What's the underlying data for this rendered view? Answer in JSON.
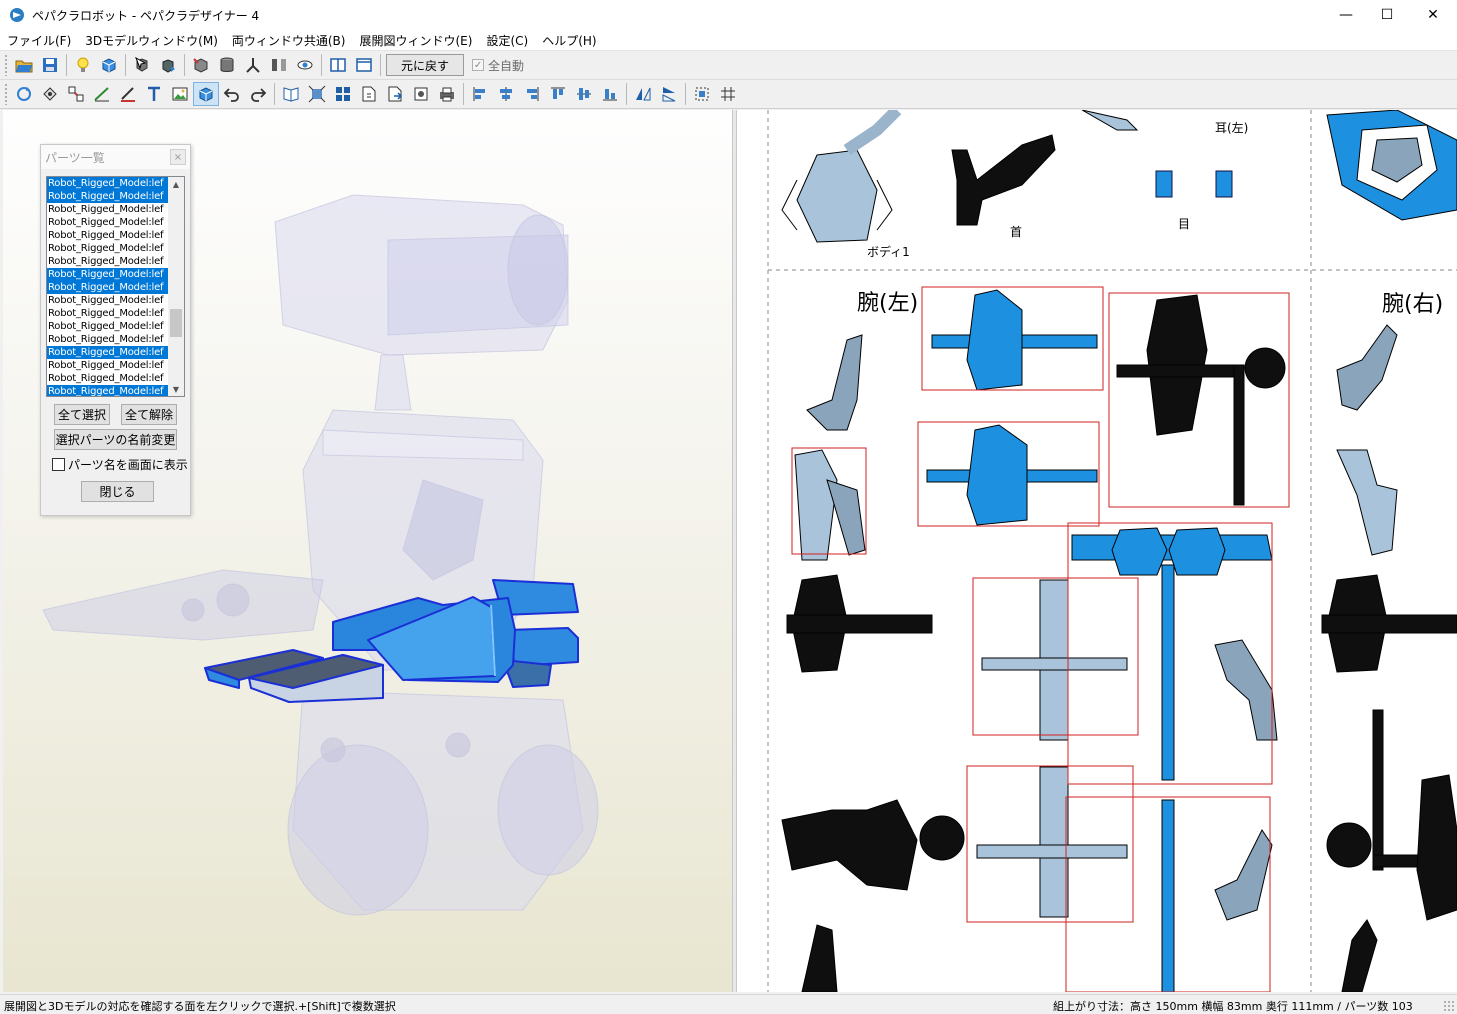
{
  "window": {
    "title": "ペパクラロボット - ペパクラデザイナー 4",
    "minimize": "—",
    "maximize": "☐",
    "close": "✕"
  },
  "menu": [
    "ファイル(F)",
    "3Dモデルウィンドウ(M)",
    "両ウィンドウ共通(B)",
    "展開図ウィンドウ(E)",
    "設定(C)",
    "ヘルプ(H)"
  ],
  "toolbar1": {
    "icons": [
      "open-icon",
      "save-icon",
      "lightbulb-icon",
      "texture-icon",
      "select-part-icon",
      "move-part-icon",
      "box-icon",
      "cylinder-icon",
      "axis-icon",
      "split-icon",
      "eye-icon",
      "two-pane-icon",
      "single-pane-icon"
    ],
    "undo_view_label": "元に戻す",
    "auto_all_label": "全自動",
    "auto_all_checked": true
  },
  "toolbar2": {
    "icons": [
      "rotate-icon",
      "flap-icon",
      "join-icon",
      "line-icon",
      "edge-icon",
      "text-icon",
      "image-icon",
      "cube-icon",
      "undo-icon",
      "redo-icon",
      "book-icon",
      "fit-icon",
      "layout-icon",
      "page-number-icon",
      "export-icon",
      "print-preview-icon",
      "print-icon",
      "align-left-icon",
      "align-center-icon",
      "align-right-icon",
      "align-top-icon",
      "align-middle-icon",
      "align-bottom-icon",
      "flip-h-icon",
      "flip-v-icon",
      "zoom-fit-icon",
      "grid-icon"
    ]
  },
  "parts_dialog": {
    "title": "パーツ一覧",
    "close": "×",
    "rows": [
      {
        "label": "Robot_Rigged_Model:lef",
        "selected": true
      },
      {
        "label": "Robot_Rigged_Model:lef",
        "selected": true
      },
      {
        "label": "Robot_Rigged_Model:lef",
        "selected": false
      },
      {
        "label": "Robot_Rigged_Model:lef",
        "selected": false
      },
      {
        "label": "Robot_Rigged_Model:lef",
        "selected": false
      },
      {
        "label": "Robot_Rigged_Model:lef",
        "selected": false
      },
      {
        "label": "Robot_Rigged_Model:lef",
        "selected": false
      },
      {
        "label": "Robot_Rigged_Model:lef",
        "selected": true
      },
      {
        "label": "Robot_Rigged_Model:lef",
        "selected": true
      },
      {
        "label": "Robot_Rigged_Model:lef",
        "selected": false
      },
      {
        "label": "Robot_Rigged_Model:lef",
        "selected": false
      },
      {
        "label": "Robot_Rigged_Model:lef",
        "selected": false
      },
      {
        "label": "Robot_Rigged_Model:lef",
        "selected": false
      },
      {
        "label": "Robot_Rigged_Model:lef",
        "selected": true
      },
      {
        "label": "Robot_Rigged_Model:lef",
        "selected": false
      },
      {
        "label": "Robot_Rigged_Model:lef",
        "selected": false
      },
      {
        "label": "Robot_Rigged_Model:lef",
        "selected": true
      }
    ],
    "select_all": "全て選択",
    "deselect_all": "全て解除",
    "rename": "選択パーツの名前変更",
    "show_names": "パーツ名を画面に表示",
    "show_names_checked": false,
    "close_button": "閉じる"
  },
  "sheet_labels": {
    "ear_left": "耳(左)",
    "body1": "ボディ1",
    "neck": "首",
    "eye": "目",
    "arm_left": "腕(左)",
    "arm_right": "腕(右)"
  },
  "colors": {
    "selection_blue": "#0078d7",
    "part_blue": "#1e90e0",
    "part_light": "#a9c4da",
    "part_dark": "#0c0c10",
    "highlight_red": "#d22020"
  },
  "status": {
    "hint": "展開図と3Dモデルの対応を確認する面を左クリックで選択.+[Shift]で複数選択",
    "info": "組上がり寸法：高さ 150mm 横幅 83mm 奥行 111mm / パーツ数 103"
  }
}
